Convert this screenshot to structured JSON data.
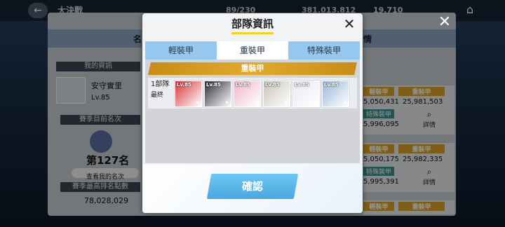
{
  "background": {
    "header_title": "大決戰",
    "currency_1": "89/230",
    "currency_2": "381,013,812",
    "currency_3": "19,710",
    "left_header_partial": "名",
    "right_header_partial": "情",
    "my_info_label": "我的資訊",
    "player_name": "安守實里",
    "player_level": "Lv.85",
    "season_rank_label": "賽季目前名次",
    "season_rank_value": "第127名",
    "view_rank_button": "查看我的名次",
    "season_best_label": "賽季最高排名點數",
    "season_best_value": "78,028,029",
    "rows": [
      {
        "light_label": "輕裝甲",
        "heavy_label": "重裝甲",
        "light_value": "5,050,431",
        "heavy_value": "25,981,503",
        "special_label": "特殊裝甲",
        "special_value": "5,996,095",
        "detail_label": "詳情"
      },
      {
        "light_label": "輕裝甲",
        "heavy_label": "重裝甲",
        "light_value": "5,050,175",
        "heavy_value": "25,982,335",
        "special_label": "特殊裝甲",
        "special_value": "5,995,391",
        "detail_label": "詳情"
      },
      {
        "light_label": "輕裝甲",
        "heavy_label": "重裝甲"
      }
    ]
  },
  "modal": {
    "title": "部隊資訊",
    "tabs": [
      "輕裝甲",
      "重裝甲",
      "特殊裝甲"
    ],
    "active_tab": "重裝甲",
    "section_banner": "重裝甲",
    "team": {
      "name": "1部隊",
      "sub": "最終",
      "cards": [
        {
          "level": "Lv.85",
          "color": "#d9363a"
        },
        {
          "level": "Lv.85",
          "color": "#2b2b3a"
        },
        {
          "level": "Lv.85",
          "color": "#f0b6c8"
        },
        {
          "level": "Lv.85",
          "color": "#c9c2b8"
        },
        {
          "level": "Lv.85",
          "color": "#e6e9ef"
        },
        {
          "level": "Lv.85",
          "color": "#9ab8d8"
        }
      ]
    },
    "confirm_button": "確認"
  },
  "colors": {
    "tab_bar": "#96c7ee",
    "banner": "#d9a227",
    "confirm": "#4aa7e0",
    "title_underline": "#f1d21c"
  }
}
